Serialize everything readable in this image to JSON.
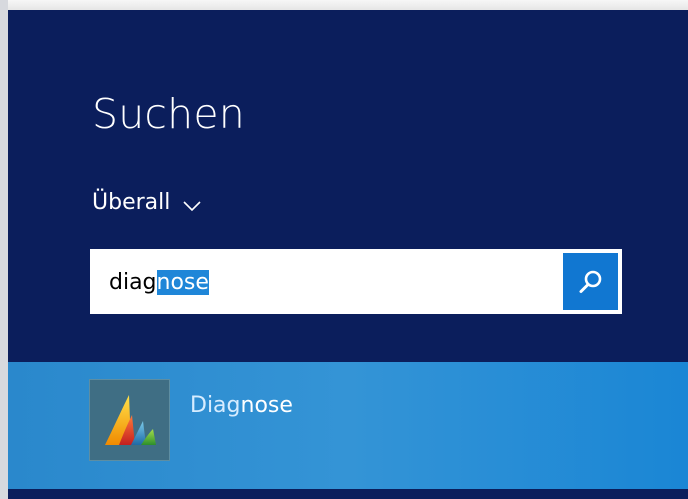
{
  "search_pane": {
    "title": "Suchen",
    "scope": {
      "label": "Überall",
      "icon": "chevron-down-icon"
    },
    "search_box": {
      "typed_text": "diag",
      "autocomplete_selection": "nose",
      "button_icon": "search-icon"
    }
  },
  "results": [
    {
      "app_icon": "dynamics-app-icon",
      "label_match": "Diag",
      "label_rest": "nose",
      "selected": true
    }
  ],
  "colors": {
    "panel_background": "#0b1e5c",
    "search_button": "#1177d1",
    "selection_highlight": "#1f86d8",
    "result_row": "#2a88cc"
  }
}
